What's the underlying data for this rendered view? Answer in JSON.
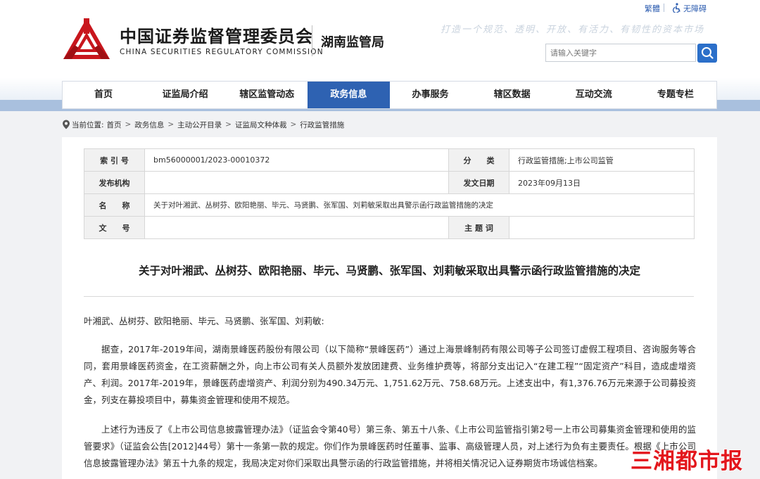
{
  "header": {
    "logo_icon": "csrc-logo-icon",
    "site_name_cn": "中国证券监督管理委员会",
    "site_name_en": "CHINA SECURITIES REGULATORY COMMISSION",
    "bureau": "湖南监管局",
    "traditional_link": "繁體",
    "accessibility_link": "无障碍",
    "slogan": "打造一个规范、透明、开放、有活力、有韧性的资本市场",
    "search_placeholder": "请输入关键字",
    "search_icon": "search-icon",
    "brand_color": "#c8161d",
    "accent_color": "#2e62b2"
  },
  "nav": {
    "items": [
      "首页",
      "证监局介绍",
      "辖区监管动态",
      "政务信息",
      "办事服务",
      "辖区数据",
      "互动交流",
      "专题专栏"
    ],
    "active_index": 3
  },
  "breadcrumb": {
    "label": "当前位置:",
    "items": [
      "首页",
      "政务信息",
      "主动公开目录",
      "证监局文种体裁",
      "行政监管措施"
    ],
    "separator": ">"
  },
  "meta": {
    "index_label": "索 引 号",
    "index_value": "bm56000001/2023-00010372",
    "category_label": "分　　类",
    "category_value": "行政监管措施;上市公司监管",
    "issuer_label": "发布机构",
    "issuer_value": "",
    "date_label": "发文日期",
    "date_value": "2023年09月13日",
    "name_label": "名　　称",
    "name_value": "关于对叶湘武、丛树芬、欧阳艳丽、毕元、马贤鹏、张军国、刘莉敏采取出具警示函行政监管措施的决定",
    "docno_label": "文　　号",
    "docno_value": "",
    "subject_label": "主 题 词",
    "subject_value": ""
  },
  "document": {
    "title": "关于对叶湘武、丛树芬、欧阳艳丽、毕元、马贤鹏、张军国、刘莉敏采取出具警示函行政监管措施的决定",
    "addressee": "叶湘武、丛树芬、欧阳艳丽、毕元、马贤鹏、张军国、刘莉敏:",
    "para1": "据查，2017年-2019年间，湖南景峰医药股份有限公司（以下简称“景峰医药”）通过上海景峰制药有限公司等子公司签订虚假工程项目、咨询服务等合同，套用景峰医药资金，在工资薪酬之外，向上市公司有关人员额外发放团建费、业务维护费等，将部分支出记入“在建工程”“固定资产”科目，造成虚增资产、利润。2017年-2019年，景峰医药虚增资产、利润分别为490.34万元、1,751.62万元、758.68万元。上述支出中，有1,376.76万元来源于公司募投资金，列支在募投项目中，募集资金管理和使用不规范。",
    "para2": "上述行为违反了《上市公司信息披露管理办法》（证监会令第40号）第三条、第五十八条、《上市公司监管指引第2号一上市公司募集资金管理和使用的监管要求》（证监会公告[2012]44号）第十一条第一款的规定。你们作为景峰医药时任董事、监事、高级管理人员，对上述行为负有主要责任。根据《上市公司信息披露管理办法》第五十九条的规定，我局决定对你们采取出具警示函的行政监管措施，并将相关情况记入证券期货市场诚信档案。"
  },
  "watermark": {
    "text": "三湘都市报",
    "color": "#e3161c"
  }
}
